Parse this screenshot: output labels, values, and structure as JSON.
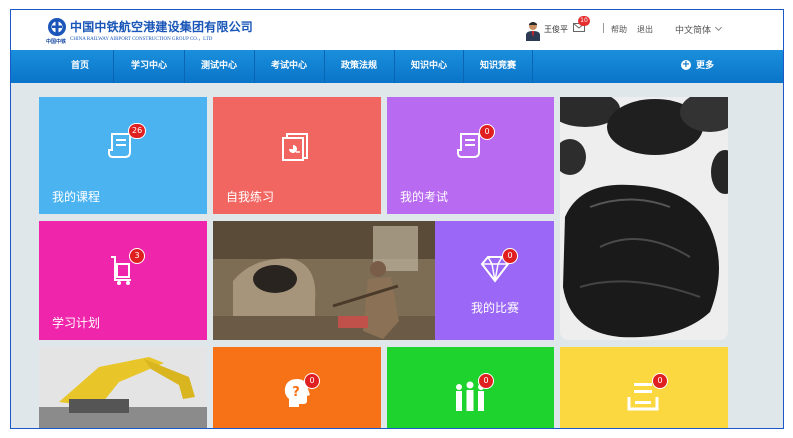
{
  "header": {
    "company_cn": "中国中铁航空港建设集团有限公司",
    "company_en": "CHINA RAILWAY AIRPORT CONSTRUCTION GROUP CO.，LTD",
    "logo_sub": "中国中铁",
    "user_name": "王俊平",
    "mail_count": "10",
    "help": "帮助",
    "logout": "退出",
    "language": "中文简体"
  },
  "nav": {
    "items": [
      "首页",
      "学习中心",
      "测试中心",
      "考试中心",
      "政策法规",
      "知识中心",
      "知识竞赛"
    ],
    "more": "更多"
  },
  "tiles": {
    "courses": {
      "label": "我的课程",
      "badge": "26",
      "color": "#4cb3f1"
    },
    "practice": {
      "label": "自我练习",
      "color": "#f26662"
    },
    "exam": {
      "label": "我的考试",
      "badge": "0",
      "color": "#b86af1"
    },
    "plan": {
      "label": "学习计划",
      "badge": "3",
      "color": "#ef25ac"
    },
    "contest": {
      "label": "我的比赛",
      "badge": "0",
      "color": "#9b67f6"
    },
    "qa": {
      "badge": "0",
      "color": "#f77216"
    },
    "group": {
      "badge": "0",
      "color": "#1fd32f"
    },
    "list": {
      "badge": "0",
      "color": "#fbd83f"
    }
  }
}
